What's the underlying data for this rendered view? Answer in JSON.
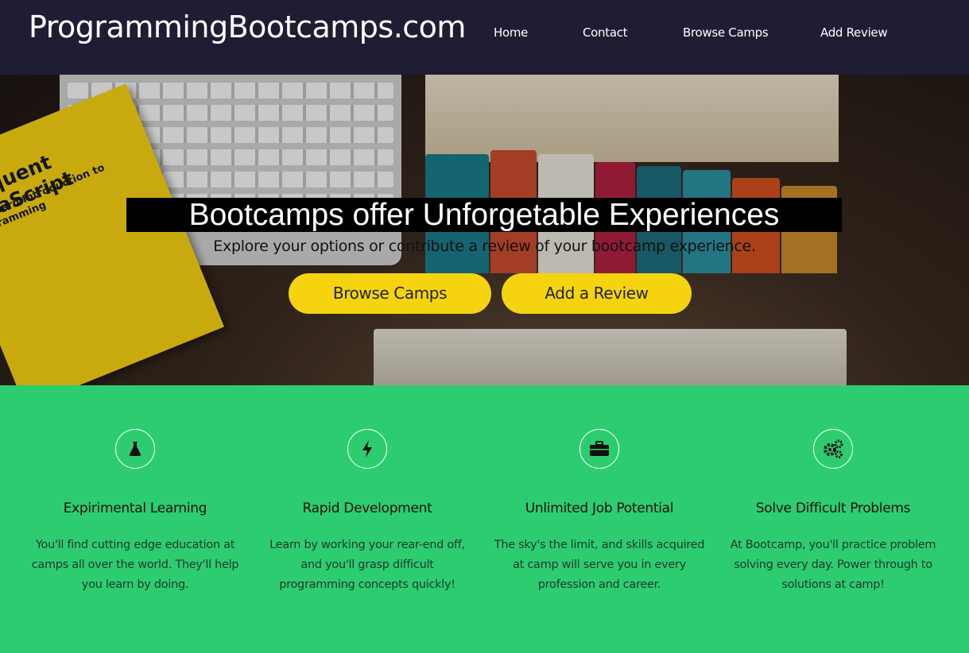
{
  "header": {
    "brand": "ProgrammingBootcamps.com",
    "nav": [
      "Home",
      "Contact",
      "Browse Camps",
      "Add Review"
    ]
  },
  "hero": {
    "headline": "Bootcamps offer Unforgetable Experiences",
    "subheading": "Explore your options or contribute a review of your bootcamp experience.",
    "primary_button": "Browse Camps",
    "secondary_button": "Add a Review",
    "background_book_title": "Eloquent JavaScript",
    "background_book_subtitle": "A Modern Introduction to Programming"
  },
  "features": [
    {
      "icon": "flask-icon",
      "title": "Expirimental Learning",
      "text": "You'll find cutting edge education at camps all over the world. They'll help you learn by doing."
    },
    {
      "icon": "lightning-bolt-icon",
      "title": "Rapid Development",
      "text": "Learn by working your rear-end off, and you'll grasp difficult programming concepts quickly!"
    },
    {
      "icon": "briefcase-icon",
      "title": "Unlimited Job Potential",
      "text": "The sky's the limit, and skills acquired at camp will serve you in every profession and career."
    },
    {
      "icon": "gears-icon",
      "title": "Solve Difficult Problems",
      "text": "At Bootcamp, you'll practice problem solving every day. Power through to solutions at camp!"
    }
  ],
  "colors": {
    "nav_background": "#1f1d34",
    "accent_green": "#2ecc71",
    "button_yellow": "#f5d40f"
  }
}
